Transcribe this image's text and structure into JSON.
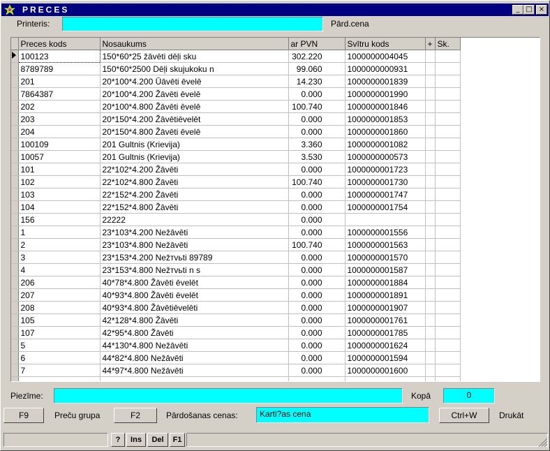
{
  "window": {
    "title": "PRECES",
    "minimize": "_",
    "maximize": "□",
    "close": "×"
  },
  "top": {
    "printer_label": "Printeris:",
    "printer_value": "",
    "price_label": "Pārd.cena"
  },
  "grid": {
    "columns": [
      "Preces kods",
      "Nosaukums",
      "ar PVN",
      "Svītru kods",
      "+",
      "Sk."
    ],
    "rows": [
      [
        "100123",
        "150*60*25 žāvēti dēļi sku",
        "302.220",
        "1000000004045"
      ],
      [
        "8789789",
        "150*60*2500 Dēļi skujukoku n",
        "99.060",
        "1000000000931"
      ],
      [
        "201",
        "20*100*4.200 Ūāvēti ēvelē",
        "14.230",
        "1000000001839"
      ],
      [
        "7864387",
        "20*100*4.200 Žāvēti ēvelē",
        "0.000",
        "1000000001990"
      ],
      [
        "202",
        "20*100*4.800 Žāvēti ēvelē",
        "100.740",
        "1000000001846"
      ],
      [
        "203",
        "20*150*4.200 Žāvētiēvelēt",
        "0.000",
        "1000000001853"
      ],
      [
        "204",
        "20*150*4.800 Žāvēti ēvelē",
        "0.000",
        "1000000001860"
      ],
      [
        "100109",
        "201 Gultnis (Krievija)",
        "3.360",
        "1000000001082"
      ],
      [
        "10057",
        "201 Gultnis (Krievija)",
        "3.530",
        "1000000000573"
      ],
      [
        "101",
        "22*102*4.200 Žāvēti",
        "0.000",
        "1000000001723"
      ],
      [
        "102",
        "22*102*4.800 Žāvēti",
        "100.740",
        "1000000001730"
      ],
      [
        "103",
        "22*152*4.200 Žāvēti",
        "0.000",
        "1000000001747"
      ],
      [
        "104",
        "22*152*4.800 Žāvēti",
        "0.000",
        "1000000001754"
      ],
      [
        "156",
        "22222",
        "0.000",
        ""
      ],
      [
        "1",
        "23*103*4.200 Nežāvēti",
        "0.000",
        "1000000001556"
      ],
      [
        "2",
        "23*103*4.800 Nežāvēti",
        "100.740",
        "1000000001563"
      ],
      [
        "3",
        "23*153*4.200 Nežтvьti 89789",
        "0.000",
        "1000000001570"
      ],
      [
        "4",
        "23*153*4.800 Nežтvьti n s",
        "0.000",
        "1000000001587"
      ],
      [
        "206",
        "40*78*4.800 Žāvēti ēvelēt",
        "0.000",
        "1000000001884"
      ],
      [
        "207",
        "40*93*4.800 Žāvēti ēvelēt",
        "0.000",
        "1000000001891"
      ],
      [
        "208",
        "40*93*4.800 Žāvētiēvelēti",
        "0.000",
        "1000000001907"
      ],
      [
        "105",
        "42*128*4.800 Žāvēti",
        "0.000",
        "1000000001761"
      ],
      [
        "107",
        "42*95*4.800 Žāvēti",
        "0.000",
        "1000000001785"
      ],
      [
        "5",
        "44*130*4.800 Nežāvēti",
        "0.000",
        "1000000001624"
      ],
      [
        "6",
        "44*82*4.800 Nežāvēti",
        "0.000",
        "1000000001594"
      ],
      [
        "7",
        "44*97*4.800 Nežāvēti",
        "0.000",
        "1000000001600"
      ]
    ]
  },
  "bottom": {
    "note_label": "Piezīme:",
    "note_value": "",
    "total_label": "Kopā",
    "total_value": "0",
    "f9": "F9",
    "group_label": "Preču grupa",
    "f2": "F2",
    "sale_prices_label": "Pārdošanas cenas:",
    "sale_prices_value": "Karti?as cena",
    "ctrlw": "Ctrl+W",
    "print_label": "Drukāt"
  },
  "status": {
    "help": "?",
    "ins": "Ins",
    "del": "Del",
    "f1": "F1"
  }
}
